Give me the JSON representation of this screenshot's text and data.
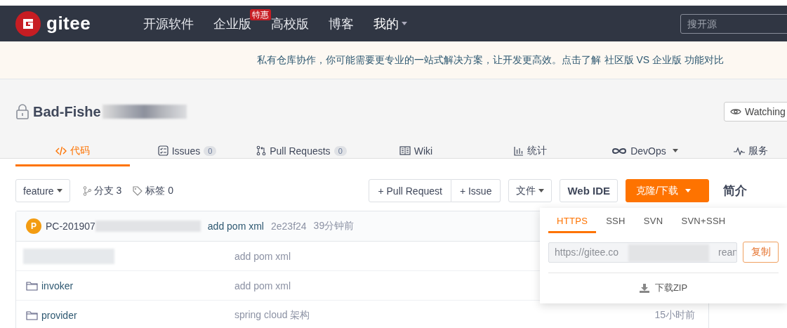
{
  "nav": {
    "logo": "gitee",
    "items": [
      {
        "label": "开源软件",
        "kind": "link"
      },
      {
        "label": "企业版",
        "kind": "link",
        "badge": "特惠"
      },
      {
        "label": "高校版",
        "kind": "link"
      },
      {
        "label": "博客",
        "kind": "link"
      },
      {
        "label": "我的",
        "kind": "menu"
      }
    ],
    "search": {
      "placeholder": "搜开源"
    }
  },
  "banner": {
    "text": "私有仓库协作，你可能需要更专业的一站式解决方案，让开发更高效。点击了解",
    "link": "社区版 VS 企业版 功能对比"
  },
  "repo": {
    "name": "Bad-Fishe",
    "private": true,
    "watch": "Watching"
  },
  "tabs": [
    {
      "label": "代码",
      "kind": "code",
      "selected": true
    },
    {
      "label": "Issues",
      "kind": "issues",
      "count": "0",
      "selected": false
    },
    {
      "label": "Pull Requests",
      "kind": "pr",
      "count": "0",
      "selected": false
    },
    {
      "label": "Wiki",
      "kind": "wiki",
      "selected": false
    },
    {
      "label": "统计",
      "kind": "stats",
      "selected": false
    },
    {
      "label": "DevOps",
      "kind": "devops",
      "menu": true,
      "selected": false
    },
    {
      "label": "服务",
      "kind": "service",
      "selected": false
    }
  ],
  "toolbar": {
    "branch": "feature",
    "branches": "分支 3",
    "tags": "标签 0",
    "buttons": [
      {
        "label": "+ Pull Request",
        "kind": "group"
      },
      {
        "label": "+ Issue",
        "kind": "group"
      },
      {
        "label": "文件",
        "kind": "menu"
      },
      {
        "label": "Web IDE",
        "kind": "bold"
      },
      {
        "label": "克隆/下载",
        "kind": "primary"
      }
    ]
  },
  "commit": {
    "avatar": "P",
    "author": "PC-201907",
    "message": "add pom xml",
    "hash": "2e23f24",
    "time": "39分钟前"
  },
  "files": [
    {
      "kind": "hidden",
      "message": "add pom xml"
    },
    {
      "kind": "folder",
      "name": "invoker",
      "message": "add pom xml"
    },
    {
      "kind": "folder",
      "name": "provider",
      "message": "spring cloud 架构",
      "time": "15小时前"
    }
  ],
  "sidebar": {
    "title": "简介"
  },
  "clone": {
    "tabs": [
      {
        "label": "HTTPS",
        "selected": true
      },
      {
        "label": "SSH",
        "selected": false
      },
      {
        "label": "SVN",
        "selected": false
      },
      {
        "label": "SVN+SSH",
        "selected": false
      }
    ],
    "url_start": "https://gitee.co",
    "url_end": "rean",
    "copy": "复制",
    "download": "下载ZIP"
  }
}
